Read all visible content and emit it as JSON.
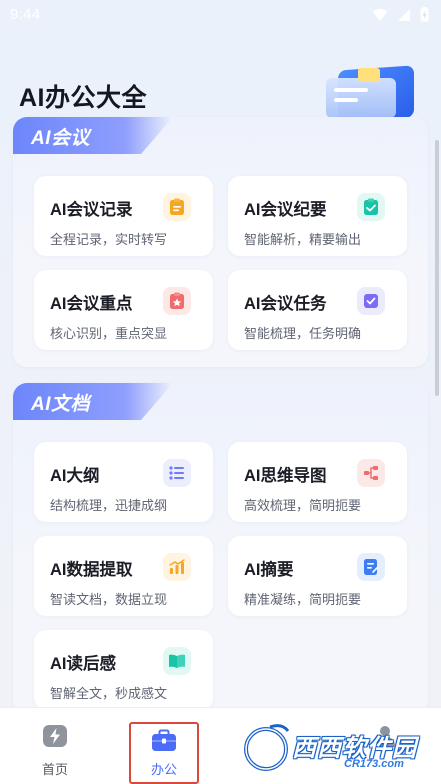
{
  "status_bar": {
    "time": "9:44"
  },
  "page": {
    "title": "AI办公大全"
  },
  "sections": [
    {
      "title": "AI会议",
      "tools": [
        {
          "title": "AI会议记录",
          "subtitle": "全程记录，实时转写",
          "icon": "clipboard-icon",
          "color": "#f5a623"
        },
        {
          "title": "AI会议纪要",
          "subtitle": "智能解析，精要输出",
          "icon": "checklist-icon",
          "color": "#19c3a5"
        },
        {
          "title": "AI会议重点",
          "subtitle": "核心识别，重点突显",
          "icon": "highlight-icon",
          "color": "#f06b6b"
        },
        {
          "title": "AI会议任务",
          "subtitle": "智能梳理，任务明确",
          "icon": "task-check-icon",
          "color": "#7b6cf6"
        }
      ]
    },
    {
      "title": "AI文档",
      "tools": [
        {
          "title": "AI大纲",
          "subtitle": "结构梳理，迅捷成纲",
          "icon": "outline-list-icon",
          "color": "#6f7cf5"
        },
        {
          "title": "AI思维导图",
          "subtitle": "高效梳理，简明扼要",
          "icon": "mindmap-icon",
          "color": "#f06b6b"
        },
        {
          "title": "AI数据提取",
          "subtitle": "智读文档，数据立现",
          "icon": "bar-chart-icon",
          "color": "#f5a623"
        },
        {
          "title": "AI摘要",
          "subtitle": "精准凝练，简明扼要",
          "icon": "summary-doc-icon",
          "color": "#3d7cf2"
        },
        {
          "title": "AI读后感",
          "subtitle": "智解全文，秒成感文",
          "icon": "open-book-icon",
          "color": "#19c3a5"
        }
      ]
    }
  ],
  "bottom_nav": [
    {
      "label": "首页",
      "icon": "lightning-icon",
      "active": false
    },
    {
      "label": "办公",
      "icon": "briefcase-icon",
      "active": true
    },
    {
      "label": "",
      "icon": "person-icon",
      "active": false
    }
  ],
  "watermark": {
    "text": "西西软件园",
    "url": "CR173.com"
  },
  "colors": {
    "accent": "#4a6cf7",
    "header_gradient_start": "#6c86fb",
    "highlight_border": "#d9483b"
  }
}
